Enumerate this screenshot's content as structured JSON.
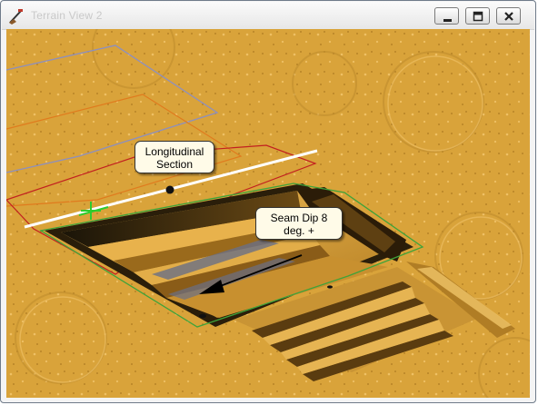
{
  "window": {
    "title": "Terrain View 2",
    "icons": {
      "app": "terrain-app-icon",
      "minimize": "minimize-icon",
      "maximize": "maximize-icon",
      "close": "close-icon"
    }
  },
  "labels": {
    "longitudinal": [
      "Longitudinal",
      "Section"
    ],
    "seam_dip": [
      "Seam Dip 8",
      "deg. +"
    ]
  },
  "colors": {
    "terrain": "#d9a33a",
    "pit_boundary": "#3fa33a",
    "section_line": "#ffffff",
    "dip_arrow": "#000000",
    "callout_fill": "#fffbe8",
    "outline_red": "#c22020",
    "outline_orange": "#e07b1e",
    "outline_grey": "#8c8fc0",
    "crosshair": "#2ecc2e"
  }
}
